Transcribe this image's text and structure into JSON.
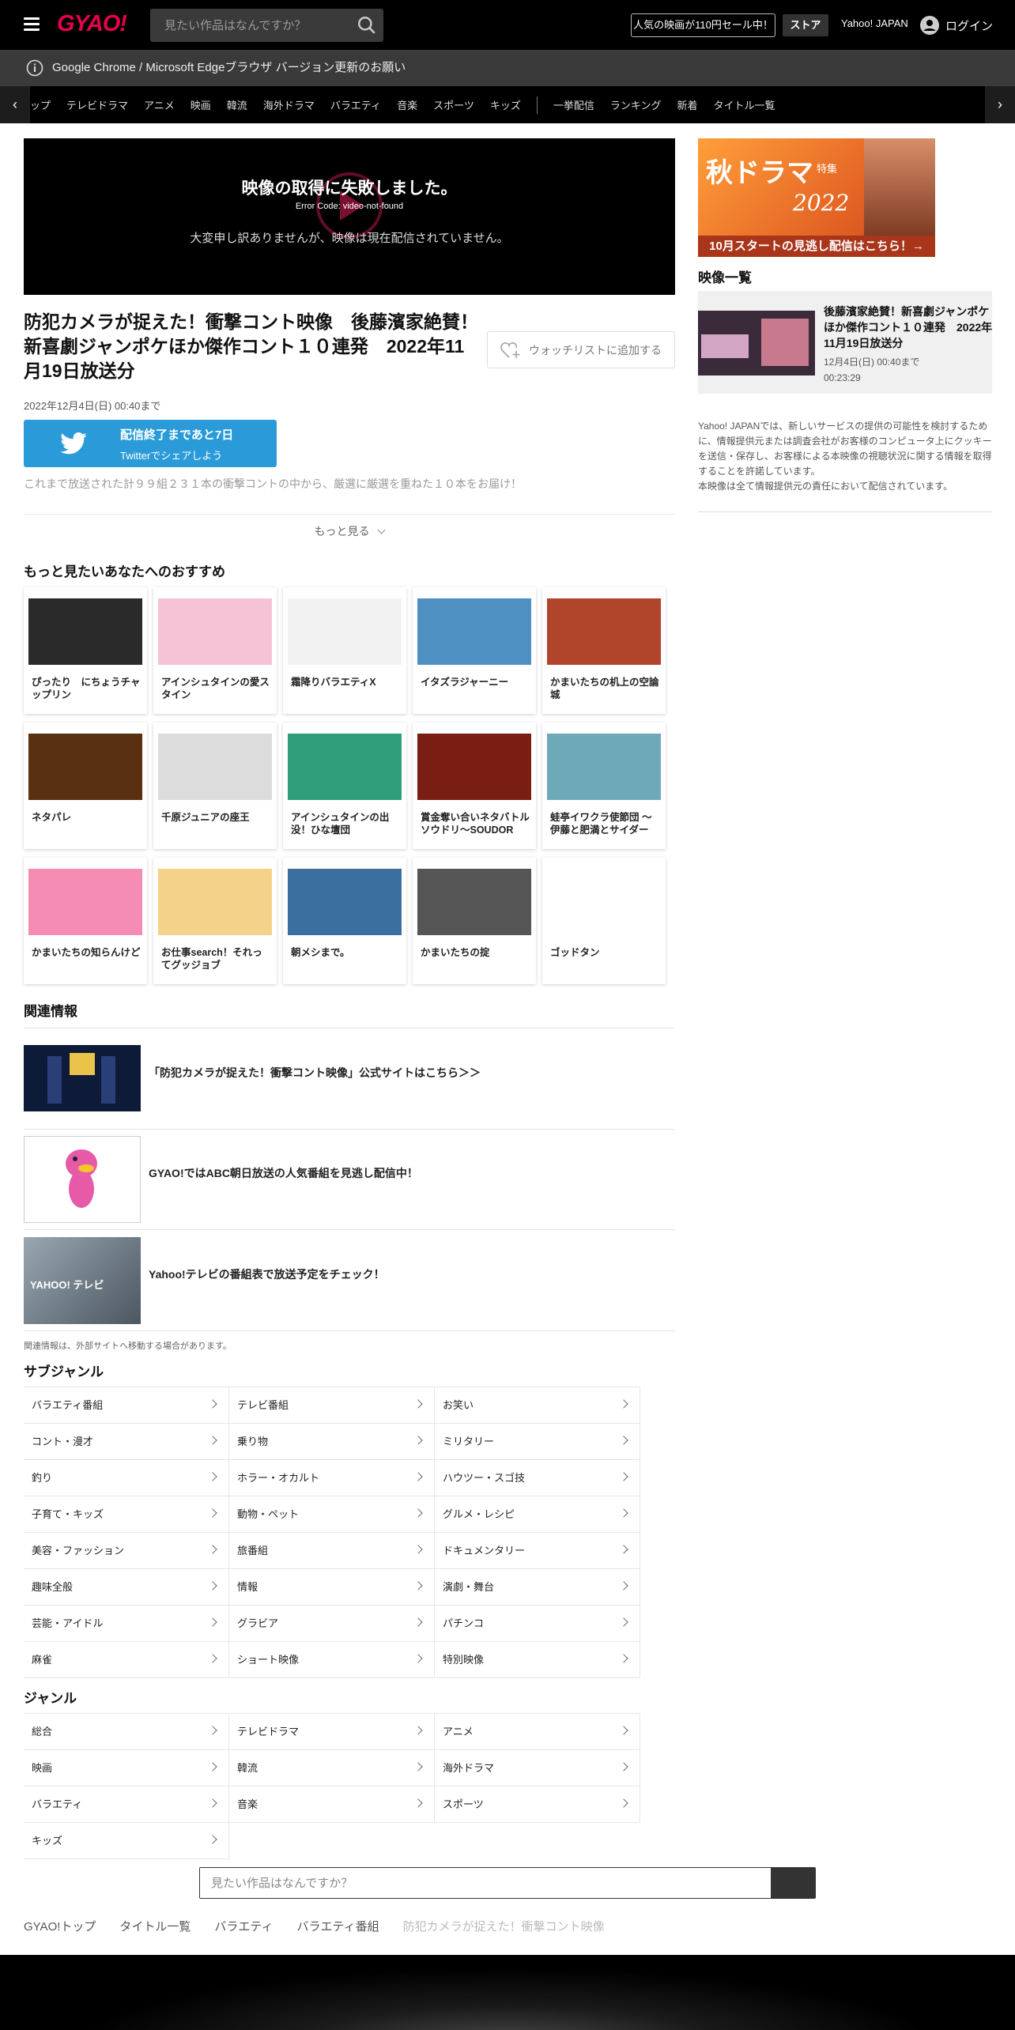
{
  "header": {
    "logo": "GYAO!",
    "search_placeholder": "見たい作品はなんですか？",
    "sale_label": "人気の映画が110円セール中！",
    "store_label": "ストア",
    "yahoo_link": "Yahoo! JAPAN",
    "login_label": "ログイン"
  },
  "notice": "Google Chrome / Microsoft Edgeブラウザ バージョン更新のお願い",
  "genre_nav": [
    "ップ",
    "テレビドラマ",
    "アニメ",
    "映画",
    "韓流",
    "海外ドラマ",
    "バラエティ",
    "音楽",
    "スポーツ",
    "キッズ",
    "|",
    "一挙配信",
    "ランキング",
    "新着",
    "タイトル一覧"
  ],
  "player": {
    "error_title": "映像の取得に失敗しました。",
    "error_code": "Error Code: video-not-found",
    "error_message": "大変申し訳ありませんが、映像は現在配信されていません。"
  },
  "video": {
    "title": "防犯カメラが捉えた！衝撃コント映像　後藤濱家絶賛！新喜劇ジャンポケほか傑作コント１０連発　2022年11月19日放送分",
    "watchlist_label": "ウォッチリストに追加する",
    "end_date": "2022年12月4日(日) 00:40まで",
    "twitter_line1": "配信終了まであと7日",
    "twitter_line2": "Twitterでシェアしよう",
    "description": "これまで放送された計９９組２３１本の衝撃コントの中から、厳選に厳選を重ねた１０本をお届け！",
    "more_label": "もっと見る"
  },
  "recommend": {
    "title": "もっと見たいあなたへのおすすめ",
    "items": [
      {
        "label": "ぴったり　にちょうチャップリン",
        "color": "#2a2a2a"
      },
      {
        "label": "アインシュタインの愛スタイン",
        "color": "#f6c3d6"
      },
      {
        "label": "霜降りバラエティX",
        "color": "#f2f2f2"
      },
      {
        "label": "イタズラジャーニー",
        "color": "#4f90c2"
      },
      {
        "label": "かまいたちの机上の空論城",
        "color": "#b0452c"
      },
      {
        "label": "ネタパレ",
        "color": "#5a3012"
      },
      {
        "label": "千原ジュニアの座王",
        "color": "#dcdcdc"
      },
      {
        "label": "アインシュタインの出没！ひな壇団",
        "color": "#2f9d7a"
      },
      {
        "label": "賞金奪い合いネタバトル ソウドリ～SOUDOR",
        "color": "#7a1e14"
      },
      {
        "label": "蛙亭イワクラ使節団 ～伊藤と肥満とサイダー",
        "color": "#6da9b7"
      },
      {
        "label": "かまいたちの知らんけど",
        "color": "#f48cb3"
      },
      {
        "label": "お仕事search！それってグッジョブ",
        "color": "#f4d28a"
      },
      {
        "label": "朝メシまで。",
        "color": "#3a6fa0"
      },
      {
        "label": "かまいたちの掟",
        "color": "#555555"
      },
      {
        "label": "ゴッドタン",
        "color": "#ffffff"
      }
    ]
  },
  "related": {
    "title": "関連情報",
    "items": [
      {
        "label": "「防犯カメラが捉えた！衝撃コント映像」公式サイトはこちら＞＞"
      },
      {
        "label": "GYAO!ではABC朝日放送の人気番組を見逃し配信中！"
      },
      {
        "label": "Yahoo!テレビの番組表で放送予定をチェック！"
      }
    ],
    "note": "関連情報は、外部サイトへ移動する場合があります。",
    "img3_text": "YAHOO! テレビ"
  },
  "subgenre": {
    "title": "サブジャンル",
    "items": [
      "バラエティ番組",
      "テレビ番組",
      "お笑い",
      "コント・漫才",
      "乗り物",
      "ミリタリー",
      "釣り",
      "ホラー・オカルト",
      "ハウツー・スゴ技",
      "子育て・キッズ",
      "動物・ペット",
      "グルメ・レシピ",
      "美容・ファッション",
      "旅番組",
      "ドキュメンタリー",
      "趣味全般",
      "情報",
      "演劇・舞台",
      "芸能・アイドル",
      "グラビア",
      "パチンコ",
      "麻雀",
      "ショート映像",
      "特別映像"
    ]
  },
  "genre": {
    "title": "ジャンル",
    "items": [
      "総合",
      "テレビドラマ",
      "アニメ",
      "映画",
      "韓流",
      "海外ドラマ",
      "バラエティ",
      "音楽",
      "スポーツ",
      "キッズ"
    ]
  },
  "sidebar": {
    "banner_title": "秋ドラマ",
    "banner_sub": "特集",
    "banner_year": "2022",
    "banner_caption": "10月スタートの見逃し配信はこちら！→",
    "video_list_title": "映像一覧",
    "item_title": "後藤濱家絶賛！新喜劇ジャンポケほか傑作コント１０連発　2022年11月19日放送分",
    "item_date": "12月4日(日) 00:40まで",
    "item_duration": "00:23:29",
    "notice": "Yahoo! JAPANでは、新しいサービスの提供の可能性を検討するために、情報提供元または調査会社がお客様のコンピュータ上にクッキーを送信・保存し、お客様による本映像の視聴状況に関する情報を取得することを許諾しています。\n本映像は全て情報提供元の責任において配信されています。"
  },
  "bottom_search_placeholder": "見たい作品はなんですか？",
  "breadcrumbs": [
    "GYAO!トップ",
    "タイトル一覧",
    "バラエティ",
    "バラエティ番組",
    "防犯カメラが捉えた！衝撃コント映像"
  ],
  "colors": {
    "brand": "#e8004d",
    "twitter": "#2a9bd8"
  }
}
